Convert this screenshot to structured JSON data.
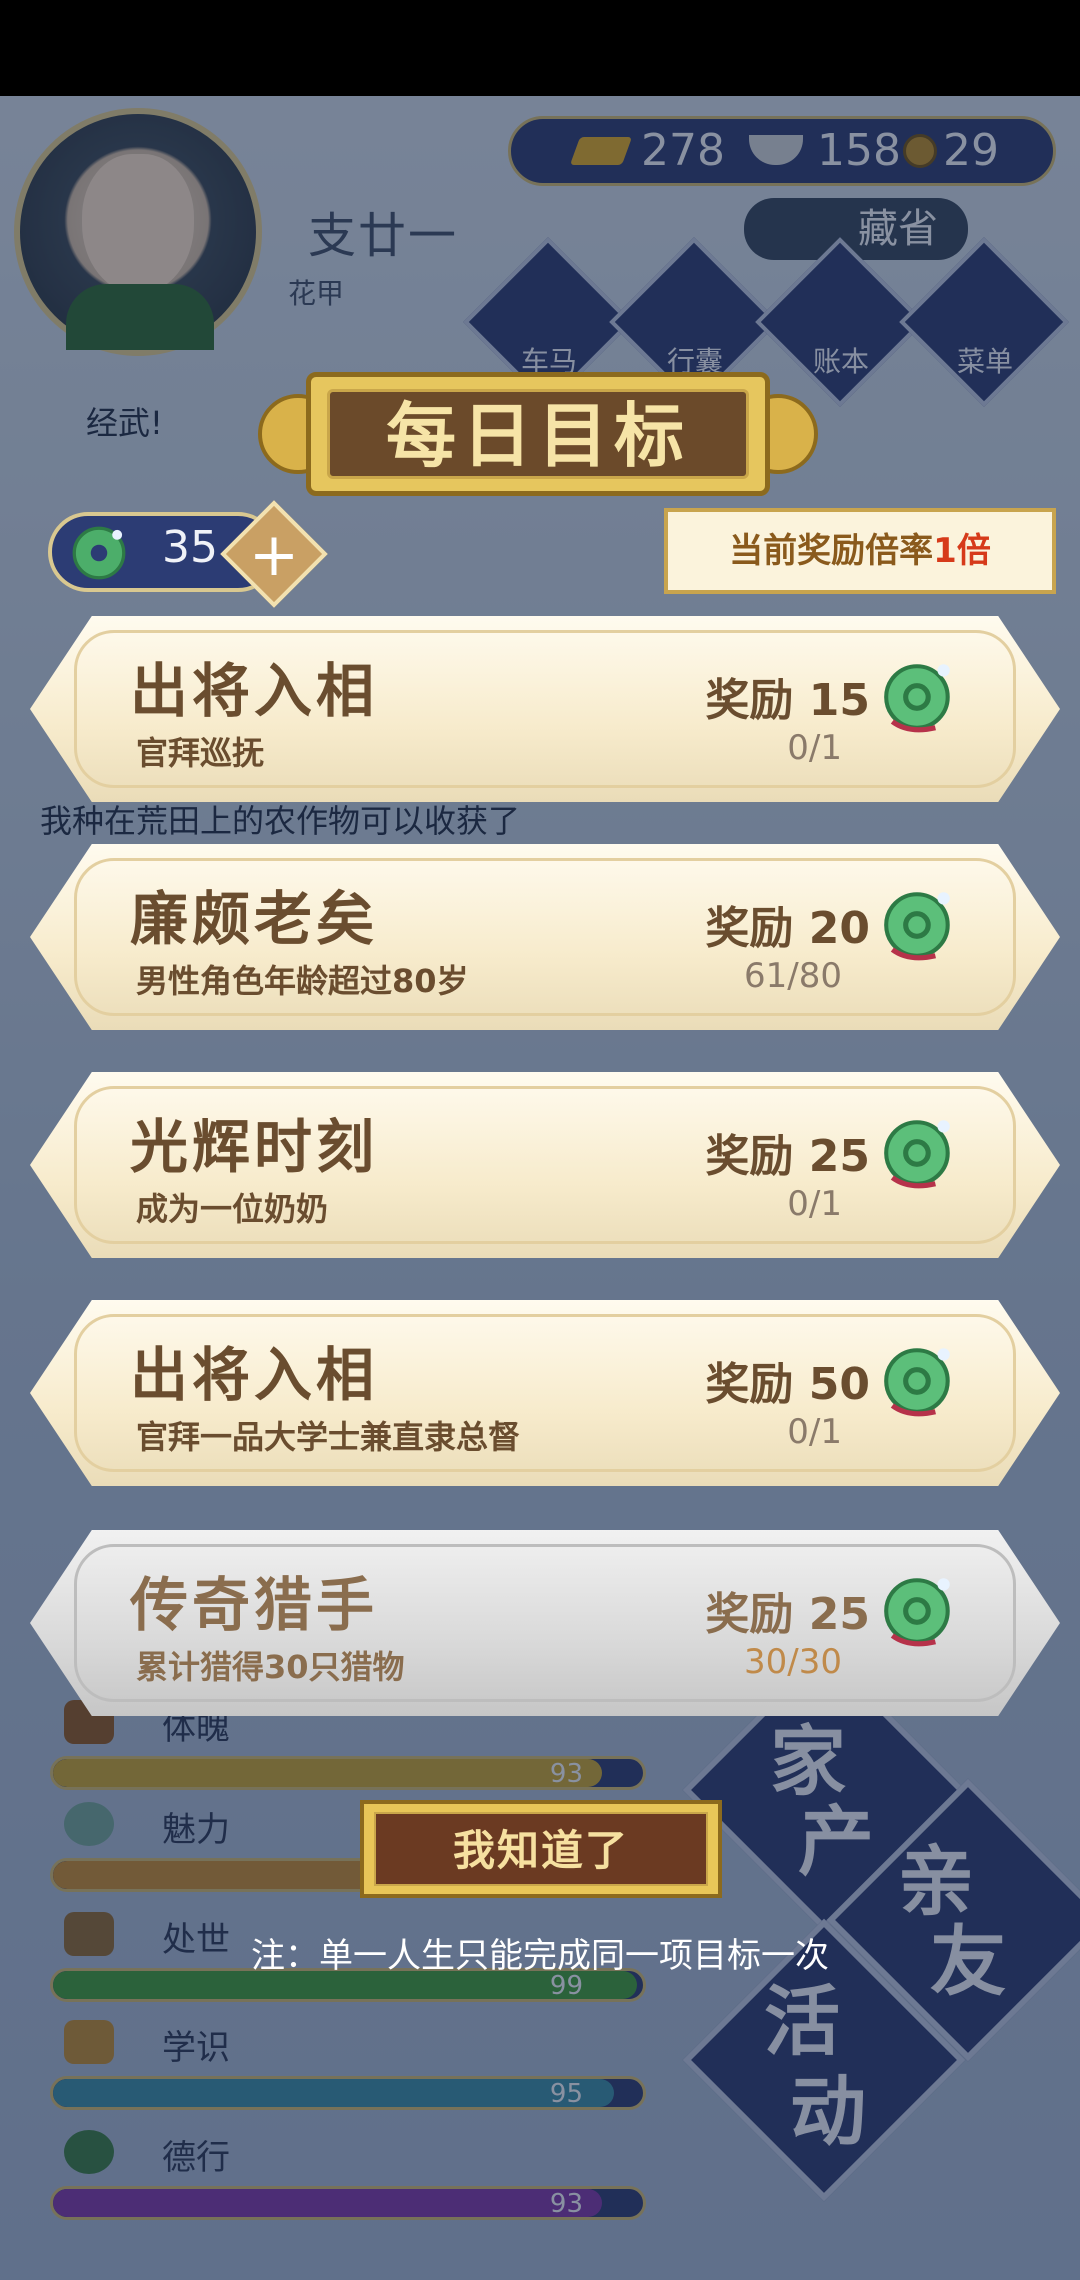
{
  "player": {
    "name": "支廿一",
    "age": "花甲"
  },
  "currency": {
    "gold": "278",
    "silver": "158",
    "coin": "29"
  },
  "top_button": "藏省",
  "nav": [
    "车马",
    "行囊",
    "账本",
    "菜单"
  ],
  "background_log": [
    "经武!",
    "我种在荒田上的农作物可以收获了"
  ],
  "bg_side_buttons": [
    "家",
    "产",
    "亲",
    "友",
    "活",
    "动"
  ],
  "stats": [
    {
      "label": "体魄",
      "value": "93",
      "color": "#c2a23a",
      "pct": 0.93
    },
    {
      "label": "魅力",
      "value": "",
      "color": "#c08a3a",
      "pct": 0.6
    },
    {
      "label": "处世",
      "value": "99",
      "color": "#3f9a3f",
      "pct": 0.99
    },
    {
      "label": "学识",
      "value": "95",
      "color": "#3a8aa6",
      "pct": 0.95
    },
    {
      "label": "德行",
      "value": "93",
      "color": "#7a3aa8",
      "pct": 0.93
    }
  ],
  "modal": {
    "title": "每日目标",
    "jade_count": "35",
    "plus": "+",
    "multiplier_prefix": "当前奖励倍率",
    "multiplier_value": "1倍",
    "goals": [
      {
        "title": "出将入相",
        "subtitle": "官拜巡抚",
        "reward": "奖励 15",
        "progress": "0/1",
        "done": false
      },
      {
        "title": "廉颇老矣",
        "subtitle": "男性角色年龄超过80岁",
        "reward": "奖励 20",
        "progress": "61/80",
        "done": false
      },
      {
        "title": "光辉时刻",
        "subtitle": "成为一位奶奶",
        "reward": "奖励 25",
        "progress": "0/1",
        "done": false
      },
      {
        "title": "出将入相",
        "subtitle": "官拜一品大学士兼直隶总督",
        "reward": "奖励 50",
        "progress": "0/1",
        "done": false
      },
      {
        "title": "传奇猎手",
        "subtitle": "累计猎得30只猎物",
        "reward": "奖励 25",
        "progress": "30/30",
        "done": true
      }
    ],
    "ack_button": "我知道了",
    "note": "注：单一人生只能完成同一项目标一次"
  },
  "colors": {
    "accent_gold": "#e6c65e",
    "plaque_brown": "#6b4a2a",
    "highlight_red": "#d63a1a"
  },
  "icons": {
    "reward": "jade-coin-icon",
    "gold": "gold-ingot-icon",
    "silver": "silver-ingot-icon",
    "coin": "copper-coin-icon"
  }
}
